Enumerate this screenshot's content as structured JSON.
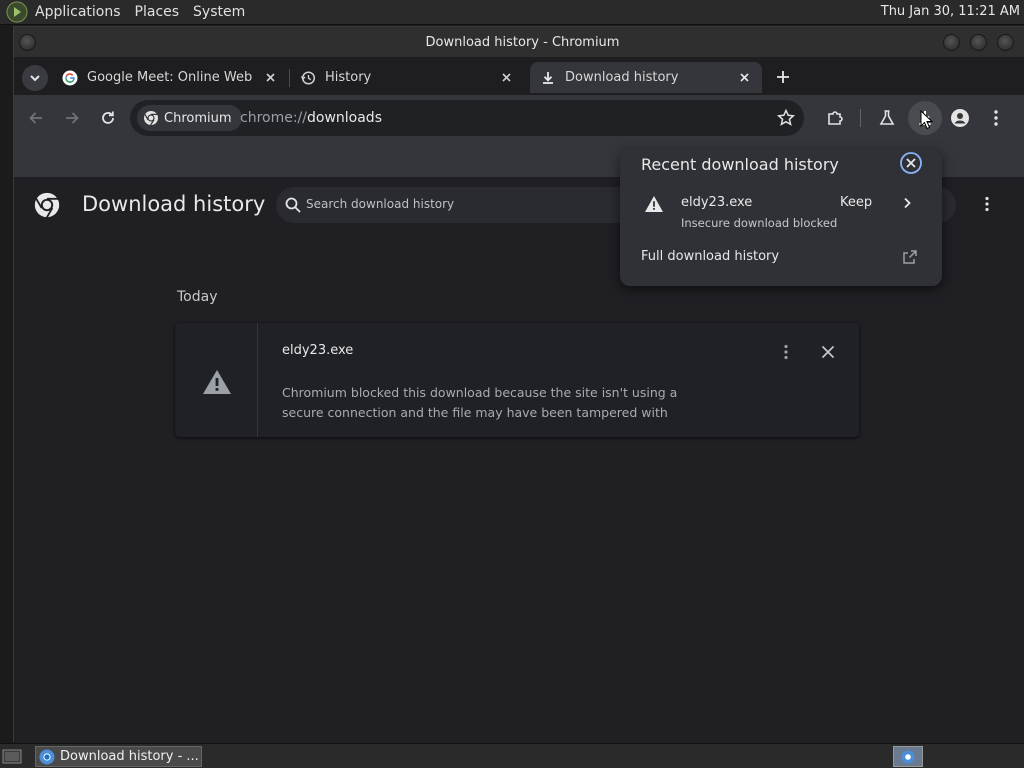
{
  "top_panel": {
    "menus": [
      "Applications",
      "Places",
      "System"
    ],
    "clock": "Thu Jan 30, 11:21 AM"
  },
  "window": {
    "title": "Download history - Chromium"
  },
  "tabs": [
    {
      "title": "Google Meet: Online Web and",
      "icon": "google-g-icon"
    },
    {
      "title": "History",
      "icon": "history-icon"
    },
    {
      "title": "Download history",
      "icon": "download-icon",
      "active": true
    }
  ],
  "toolbar": {
    "chip_label": "Chromium",
    "url_prefix": "chrome://",
    "url_host": "downloads"
  },
  "page": {
    "title": "Download history",
    "search_placeholder": "Search download history",
    "date_header": "Today",
    "item": {
      "filename": "eldy23.exe",
      "description": "Chromium blocked this download because the site isn't using a secure connection and the file may have been tampered with"
    }
  },
  "popup": {
    "title": "Recent download history",
    "filename": "eldy23.exe",
    "status": "Insecure download blocked",
    "keep_label": "Keep",
    "full_history_label": "Full download history"
  },
  "taskbar": {
    "item_label": "Download history - ..."
  },
  "colors": {
    "background": "#1f1f24",
    "toolbar": "#35363b",
    "popup": "#303136",
    "accent": "#8ab4f8"
  }
}
